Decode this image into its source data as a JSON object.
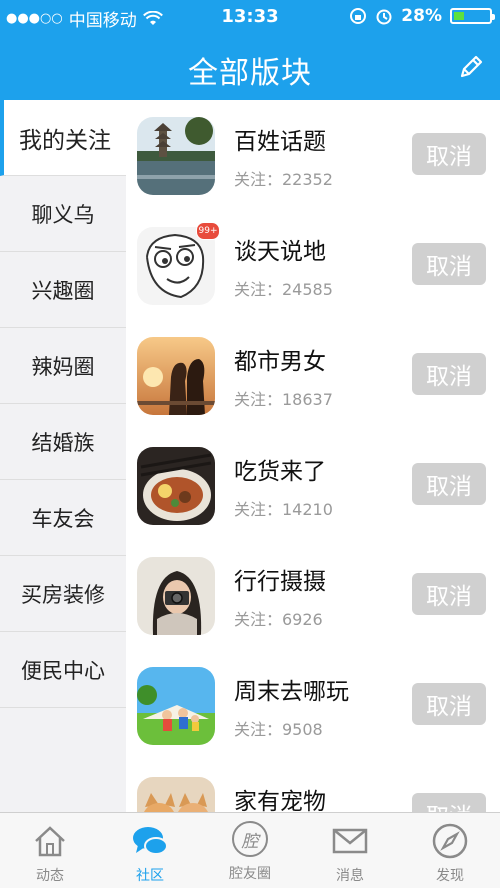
{
  "status": {
    "carrier": "中国移动",
    "time": "13:33",
    "battery": "28%",
    "battery_level": 0.28
  },
  "nav": {
    "title": "全部版块"
  },
  "sidebar": {
    "items": [
      {
        "label": "我的关注"
      },
      {
        "label": "聊义乌"
      },
      {
        "label": "兴趣圈"
      },
      {
        "label": "辣妈圈"
      },
      {
        "label": "结婚族"
      },
      {
        "label": "车友会"
      },
      {
        "label": "买房装修"
      },
      {
        "label": "便民中心"
      }
    ]
  },
  "forums": [
    {
      "name": "百姓话题",
      "follow": "关注：22352",
      "button": "取消"
    },
    {
      "name": "谈天说地",
      "follow": "关注：24585",
      "button": "取消",
      "badge": "99+"
    },
    {
      "name": "都市男女",
      "follow": "关注：18637",
      "button": "取消"
    },
    {
      "name": "吃货来了",
      "follow": "关注：14210",
      "button": "取消"
    },
    {
      "name": "行行摄摄",
      "follow": "关注：6926",
      "button": "取消"
    },
    {
      "name": "周末去哪玩",
      "follow": "关注：9508",
      "button": "取消"
    },
    {
      "name": "家有宠物",
      "follow": "",
      "button": "取消"
    }
  ],
  "tabs": [
    {
      "label": "动态"
    },
    {
      "label": "社区"
    },
    {
      "label": "腔友圈",
      "glyph": "腔"
    },
    {
      "label": "消息"
    },
    {
      "label": "发现"
    }
  ],
  "colors": {
    "accent": "#1da1ec",
    "button_gray": "#d0d0d0"
  }
}
